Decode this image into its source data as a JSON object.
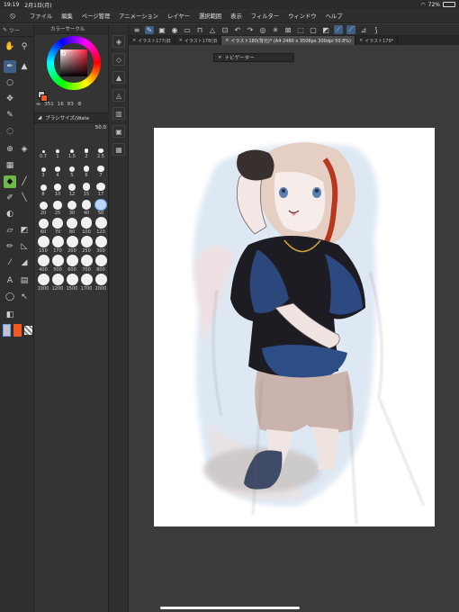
{
  "status": {
    "time": "19:19",
    "date": "2月1日(月)",
    "battery": "72%"
  },
  "menu": {
    "items": [
      "ファイル",
      "編集",
      "ページ管理",
      "アニメーション",
      "レイヤー",
      "選択範囲",
      "表示",
      "フィルター",
      "ウィンドウ",
      "ヘルプ"
    ]
  },
  "toolbox": {
    "title": "ツー"
  },
  "color_panel": {
    "title": "カラーサークル",
    "h": "351",
    "s": "16",
    "v": "83",
    "main_color": "#c5c1d4",
    "sub_color": "#ee5a22"
  },
  "brush": {
    "title": "ブラシサイズ(Wate",
    "value": "50.0"
  },
  "brush_sizes": [
    "0.7",
    "1",
    "1.5",
    "2",
    "2.5",
    "3",
    "4",
    "5",
    "6",
    "7",
    "8",
    "10",
    "12",
    "15",
    "17",
    "20",
    "25",
    "30",
    "40",
    "50",
    "60",
    "70",
    "80",
    "100",
    "120",
    "150",
    "170",
    "200",
    "250",
    "300",
    "400",
    "500",
    "600",
    "700",
    "800",
    "1000",
    "1200",
    "1500",
    "1700",
    "2000"
  ],
  "tabs": [
    {
      "label": "イラスト177(旧",
      "active": false
    },
    {
      "label": "イラスト178(旧",
      "active": false
    },
    {
      "label": "イラスト180(背元)* (A4 2480 x 3508px 300dpi 50.8%)",
      "active": true
    },
    {
      "label": "イラスト179*",
      "active": false
    }
  ],
  "navigator": {
    "title": "ナビゲーター"
  },
  "colors": {
    "accent": "#3f5f86",
    "panel": "#343434",
    "menubar": "#2e2e2e"
  }
}
